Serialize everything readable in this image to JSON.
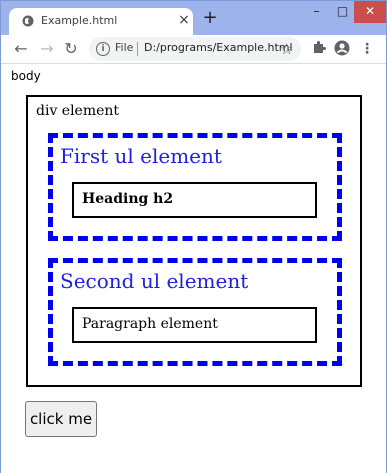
{
  "browser": {
    "tab_title": "Example.html",
    "tab_close": "×",
    "new_tab": "+",
    "omnibox_scheme": "File",
    "omnibox_url": "D:/programs/Example.html",
    "window_controls": {
      "minimize": "–",
      "maximize": "□",
      "close": "✕"
    },
    "icons": {
      "back": "back-arrow-icon",
      "forward": "forward-arrow-icon",
      "reload": "reload-icon",
      "info": "info-icon",
      "star": "star-icon",
      "extensions": "puzzle-icon",
      "profile": "profile-icon",
      "menu": "kebab-menu-icon"
    }
  },
  "page": {
    "body_label": "body",
    "div_label": "div element",
    "ul1_label": "First ul element",
    "h2_text": "Heading h2",
    "ul2_label": "Second ul element",
    "p_text": "Paragraph element",
    "button_label": "click me"
  },
  "colors": {
    "ul_border": "#0000ee",
    "ul_text": "#2020e0",
    "window_frame": "#9db3ec",
    "close_button": "#c94f4f"
  }
}
